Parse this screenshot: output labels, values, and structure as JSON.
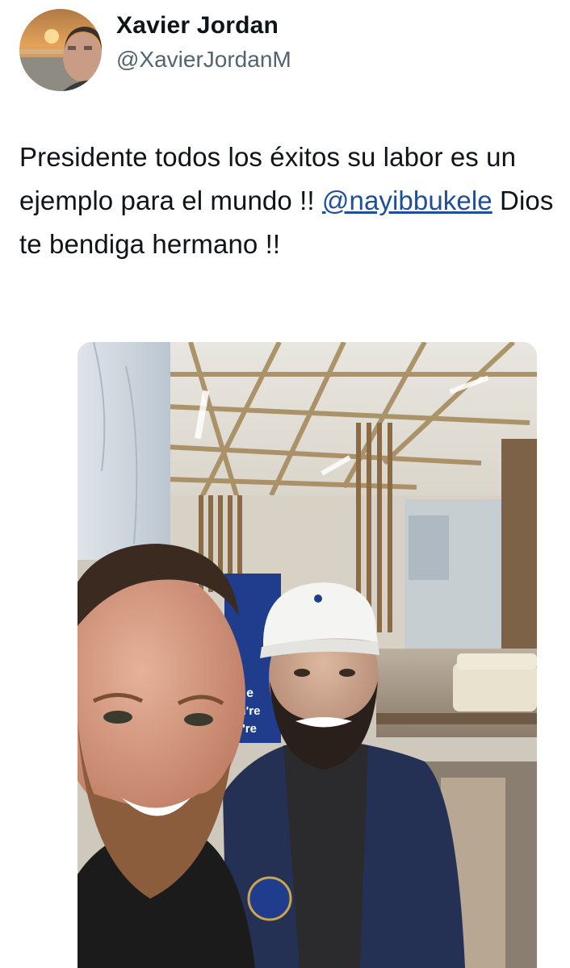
{
  "author": {
    "display_name": "Xavier Jordan",
    "handle": "@XavierJordanM"
  },
  "tweet": {
    "text_part1": "Presidente todos los éxitos su labor es un ejemplo para el mundo !!",
    "mention": "@nayibbukele",
    "text_part2": "Dios te bendiga hermano !!"
  },
  "media": {
    "alt": "Selfie of two men in a hotel lobby",
    "sign_text_lines": [
      "so e",
      "you're",
      "We're"
    ]
  }
}
